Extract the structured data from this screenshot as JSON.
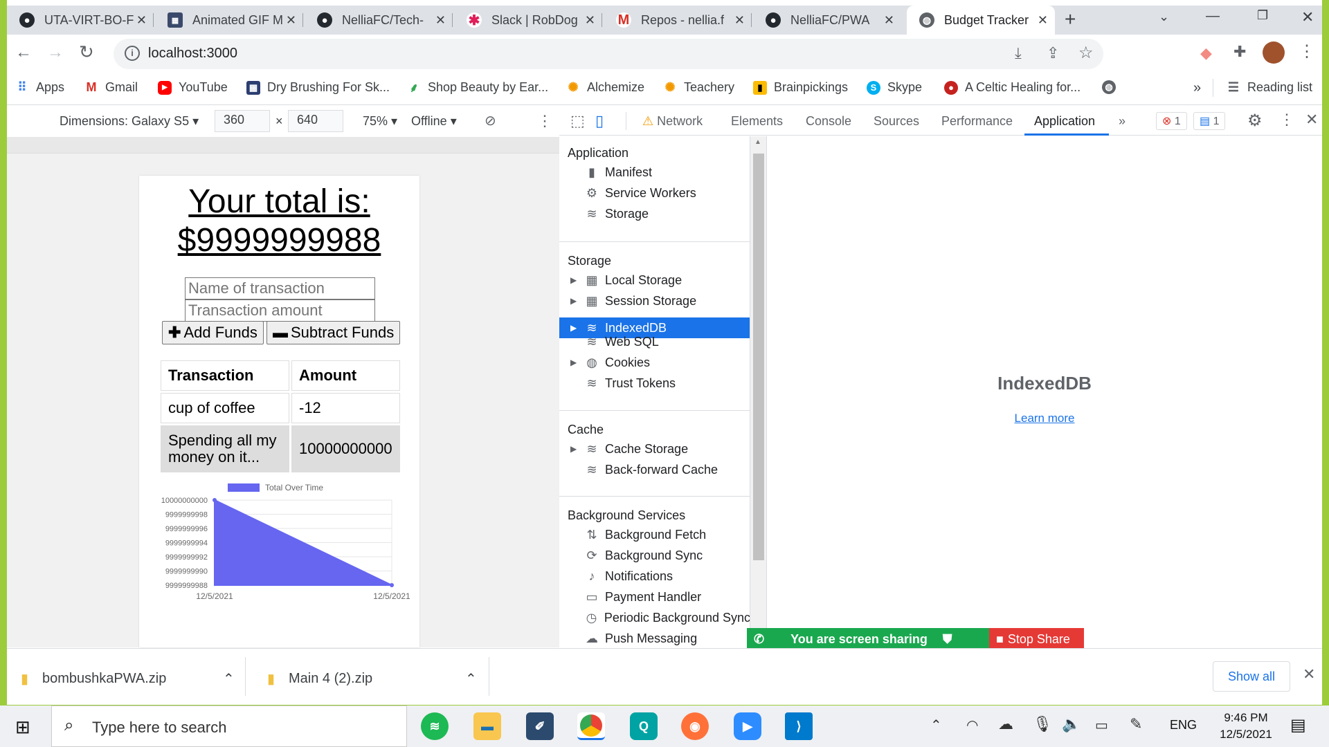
{
  "tabs": [
    {
      "title": "UTA-VIRT-BO-F",
      "icon": "github-icon"
    },
    {
      "title": "Animated GIF M",
      "icon": "gif-icon"
    },
    {
      "title": "NelliaFC/Tech-",
      "icon": "github-icon"
    },
    {
      "title": "Slack | RobDog",
      "icon": "slack-icon"
    },
    {
      "title": "Repos - nellia.f",
      "icon": "gmail-icon"
    },
    {
      "title": "NelliaFC/PWA",
      "icon": "github-icon"
    },
    {
      "title": "Budget Tracker",
      "icon": "globe-icon",
      "active": true
    }
  ],
  "address": {
    "url": "localhost:3000"
  },
  "bookmarks": [
    {
      "label": "Apps"
    },
    {
      "label": "Gmail"
    },
    {
      "label": "YouTube"
    },
    {
      "label": "Dry Brushing For Sk..."
    },
    {
      "label": "Shop Beauty by Ear..."
    },
    {
      "label": "Alchemize"
    },
    {
      "label": "Teachery"
    },
    {
      "label": "Brainpickings"
    },
    {
      "label": "Skype"
    },
    {
      "label": "A Celtic Healing for..."
    }
  ],
  "reading_list": "Reading list",
  "device_bar": {
    "dimensions": "Dimensions: Galaxy S5",
    "width": "360",
    "height": "640",
    "zoom": "75%",
    "network": "Offline"
  },
  "app": {
    "total_label": "Your total is:",
    "total_value": "$9999999988",
    "name_placeholder": "Name of transaction",
    "amount_placeholder": "Transaction amount",
    "add_label": "Add Funds",
    "subtract_label": "Subtract Funds",
    "table": {
      "headers": [
        "Transaction",
        "Amount"
      ],
      "rows": [
        [
          "cup of coffee",
          "-12"
        ],
        [
          "Spending all my money on it...",
          "10000000000"
        ]
      ]
    }
  },
  "chart_data": {
    "type": "area",
    "title": "",
    "legend": [
      "Total Over Time"
    ],
    "x": [
      "12/5/2021",
      "12/5/2021"
    ],
    "series": [
      {
        "name": "Total Over Time",
        "values": [
          10000000000,
          9999999988
        ]
      }
    ],
    "yticks": [
      "10000000000",
      "9999999998",
      "9999999996",
      "9999999994",
      "9999999992",
      "9999999990",
      "9999999988"
    ],
    "ylim": [
      9999999988,
      10000000000
    ],
    "color": "#6666f0"
  },
  "devtools": {
    "tabs": [
      "Network",
      "Elements",
      "Console",
      "Sources",
      "Performance",
      "Application"
    ],
    "active_tab": "Application",
    "error_count": "1",
    "message_count": "1",
    "sidebar": {
      "application_header": "Application",
      "application_items": [
        "Manifest",
        "Service Workers",
        "Storage"
      ],
      "storage_header": "Storage",
      "storage_items": [
        "Local Storage",
        "Session Storage",
        "IndexedDB",
        "Web SQL",
        "Cookies",
        "Trust Tokens"
      ],
      "cache_header": "Cache",
      "cache_items": [
        "Cache Storage",
        "Back-forward Cache"
      ],
      "bg_header": "Background Services",
      "bg_items": [
        "Background Fetch",
        "Background Sync",
        "Notifications",
        "Payment Handler",
        "Periodic Background Sync",
        "Push Messaging"
      ]
    },
    "main_title": "IndexedDB",
    "learn_more": "Learn more"
  },
  "screen_share": {
    "label": "You are screen sharing",
    "stop": "Stop Share"
  },
  "downloads": {
    "items": [
      "bombushkaPWA.zip",
      "Main 4 (2).zip"
    ],
    "show_all": "Show all"
  },
  "taskbar": {
    "search_placeholder": "Type here to search",
    "lang": "ENG",
    "time": "9:46 PM",
    "date": "12/5/2021"
  }
}
